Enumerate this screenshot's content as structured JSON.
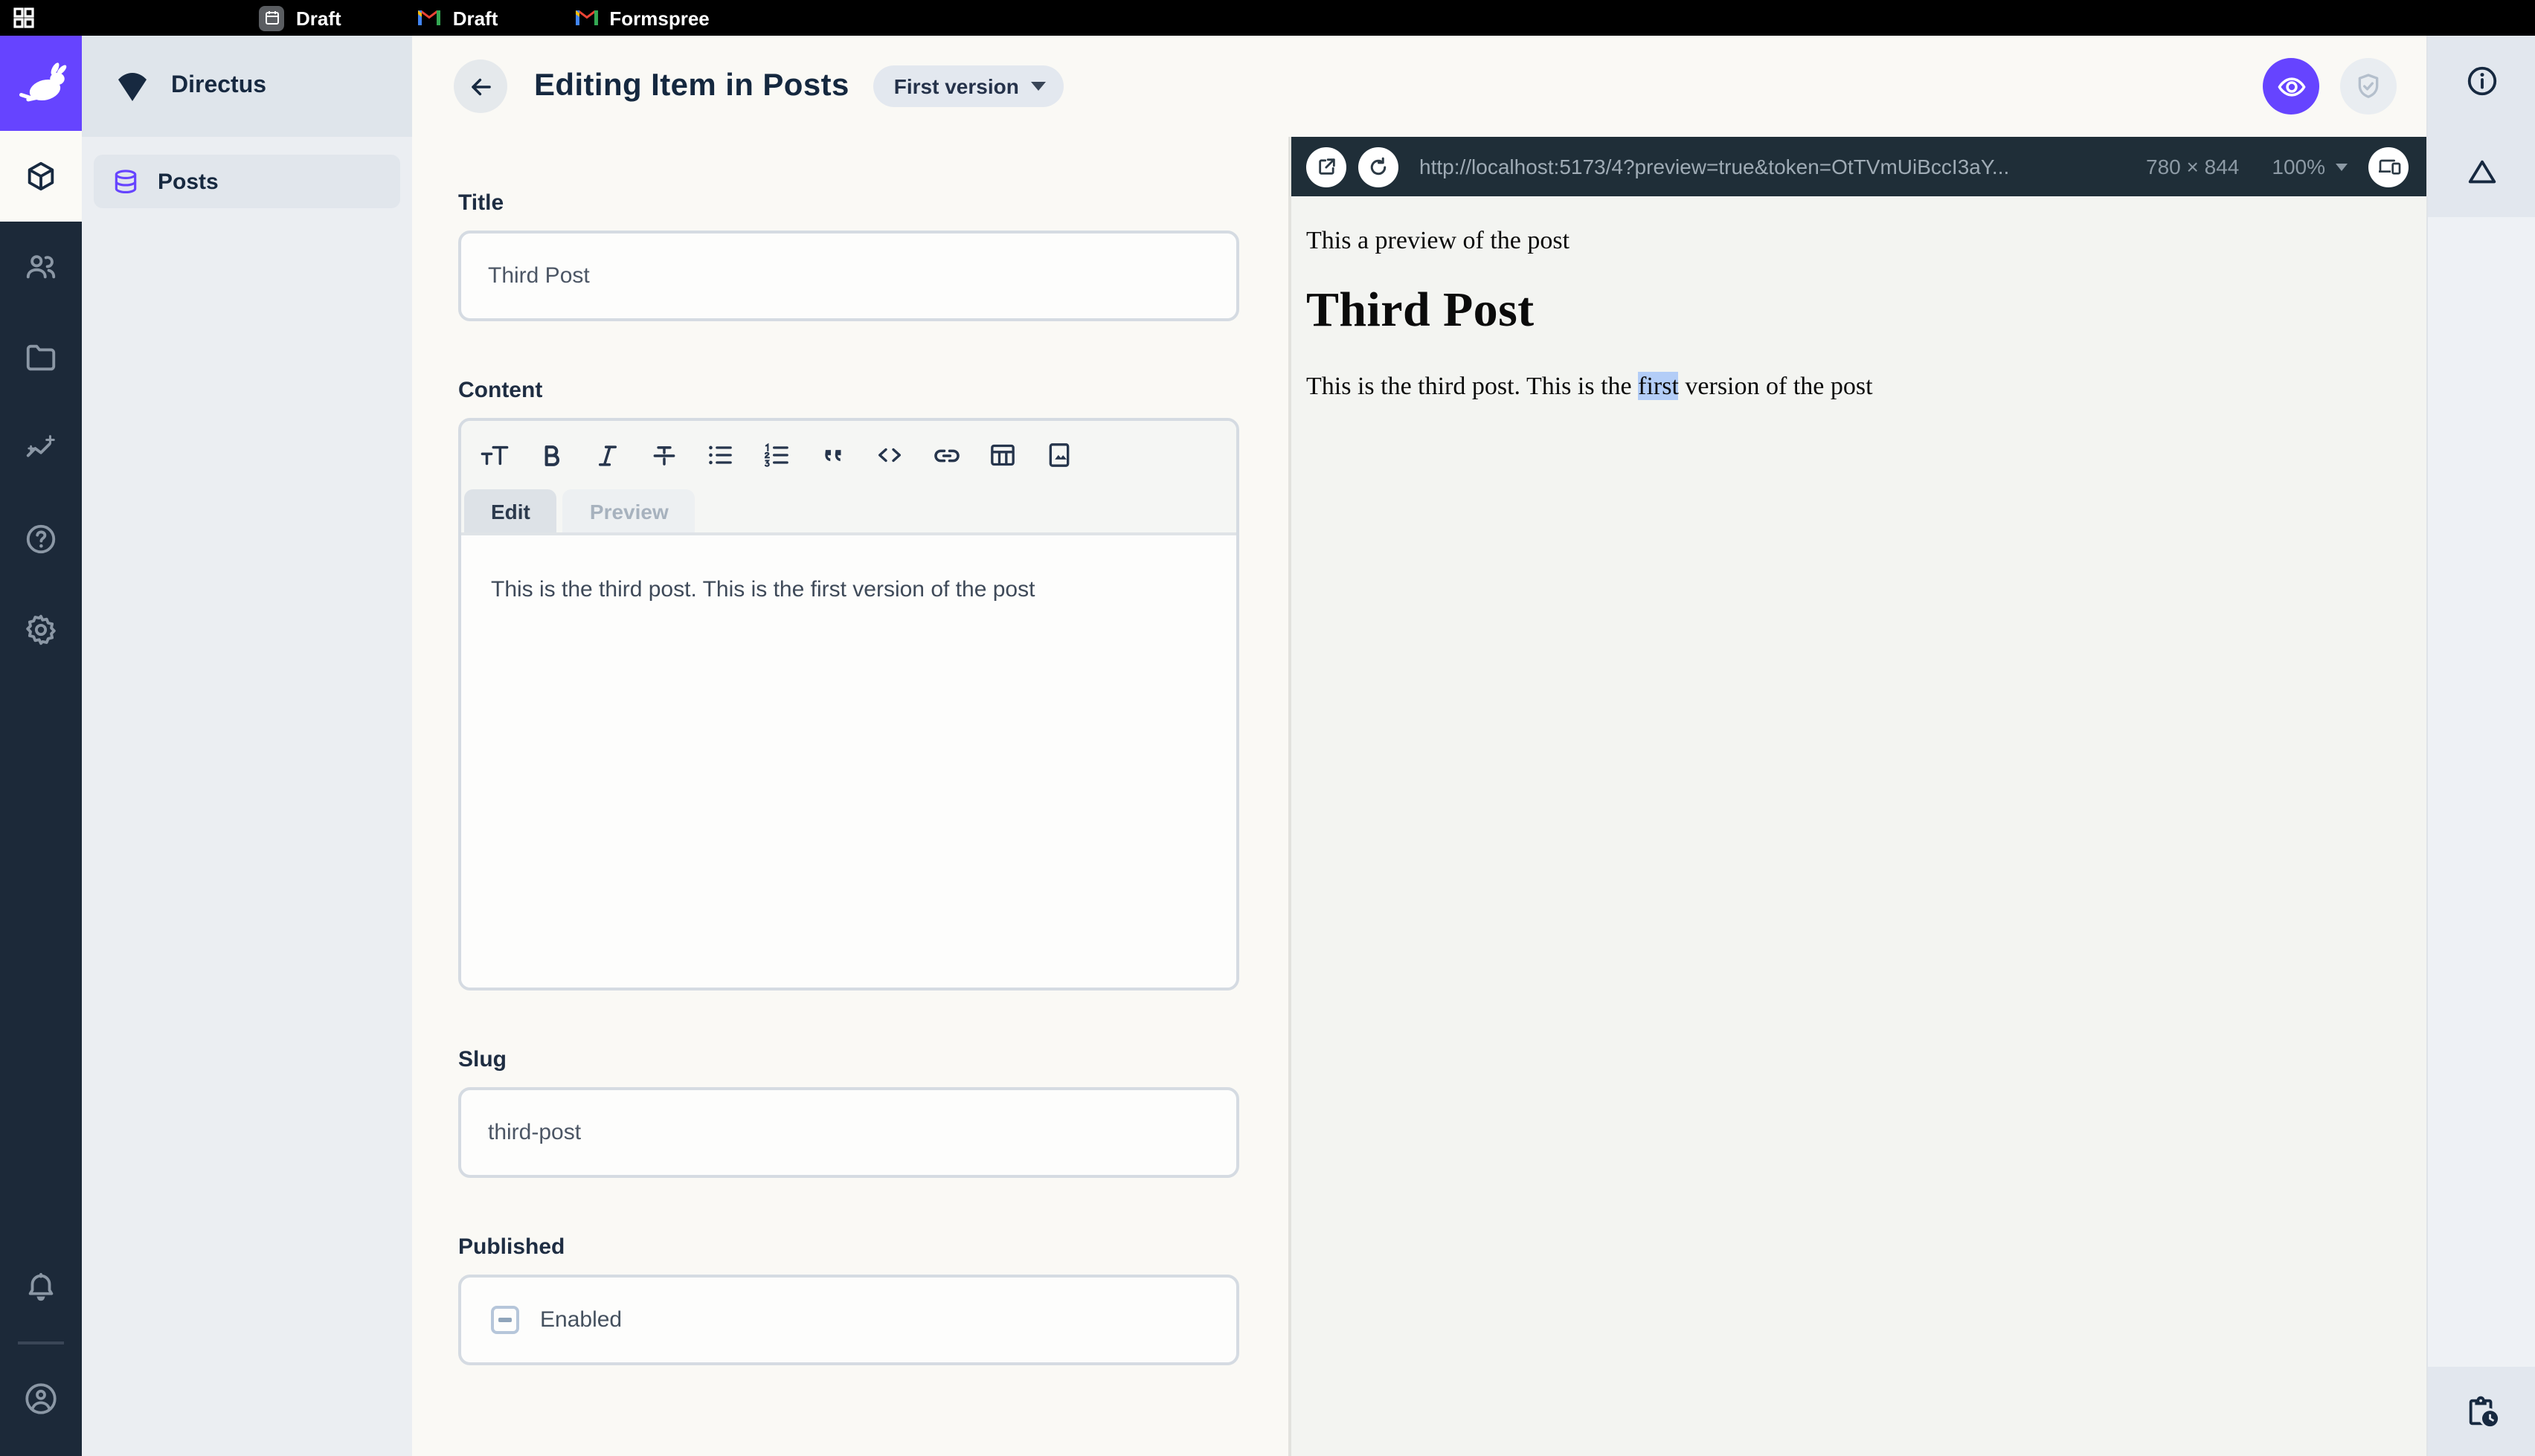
{
  "browser_bar": {
    "tabs": [
      {
        "label": "Draft",
        "icon": "calendar-31-icon"
      },
      {
        "label": "Draft",
        "icon": "gmail-icon"
      },
      {
        "label": "Formspree",
        "icon": "gmail-icon"
      }
    ]
  },
  "module_bar": {
    "items": [
      {
        "name": "content",
        "icon": "box-icon",
        "active": true
      },
      {
        "name": "users",
        "icon": "users-icon",
        "active": false
      },
      {
        "name": "files",
        "icon": "folder-icon",
        "active": false
      },
      {
        "name": "insights",
        "icon": "insights-icon",
        "active": false
      },
      {
        "name": "help",
        "icon": "help-icon",
        "active": false
      },
      {
        "name": "settings",
        "icon": "gear-icon",
        "active": false
      }
    ],
    "bottom": [
      {
        "name": "notifications",
        "icon": "bell-icon"
      },
      {
        "name": "account",
        "icon": "avatar-icon"
      }
    ]
  },
  "nav": {
    "project_name": "Directus",
    "items": [
      {
        "label": "Posts",
        "icon": "database-icon"
      }
    ]
  },
  "header": {
    "title": "Editing Item in Posts",
    "version_label": "First version"
  },
  "form": {
    "title_field": {
      "label": "Title",
      "value": "Third Post"
    },
    "content_field": {
      "label": "Content",
      "tabs": {
        "edit": "Edit",
        "preview": "Preview"
      },
      "value": "This is the third post. This is the first version of the post",
      "toolbar": [
        "format-size",
        "bold",
        "italic",
        "strikethrough",
        "bulleted-list",
        "numbered-list",
        "blockquote",
        "code",
        "link",
        "table",
        "image"
      ]
    },
    "slug_field": {
      "label": "Slug",
      "value": "third-post"
    },
    "published_field": {
      "label": "Published",
      "checkbox_label": "Enabled",
      "checkbox_state": "indeterminate"
    }
  },
  "preview": {
    "url": "http://localhost:5173/4?preview=true&token=OtTVmUiBccI3aY...",
    "dimensions": "780 × 844",
    "zoom_level": "100%",
    "content": {
      "intro": "This a preview of the post",
      "heading": "Third Post",
      "body_before": "This is the third post. This is the ",
      "body_highlight": "first",
      "body_after": " version of the post"
    }
  },
  "colors": {
    "brand_purple": "#6644ff",
    "module_bar_bg": "#1c2939",
    "preview_bar_bg": "#1f2e38",
    "page_bg": "#faf9f5",
    "nav_bg": "#ebeef2",
    "selection_highlight": "#b3cdf7",
    "title_text": "#15283f"
  }
}
